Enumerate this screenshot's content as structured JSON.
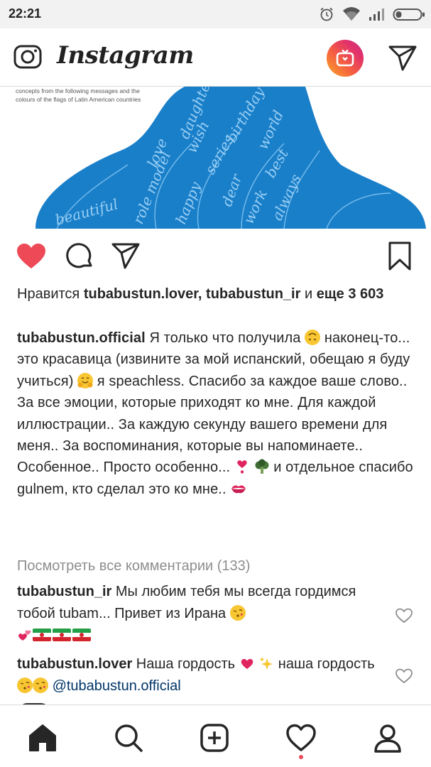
{
  "status_bar": {
    "time": "22:21",
    "icons": [
      "alarm-icon",
      "wifi-icon",
      "signal-icon",
      "battery-icon"
    ]
  },
  "header": {
    "logo_text": "Instagram",
    "icons": [
      "camera-icon",
      "igtv-icon",
      "direct-message-icon"
    ],
    "igtv_gradient": [
      "#f9a826",
      "#e1306c",
      "#c13584"
    ]
  },
  "post": {
    "image_caption_line1": "concepts from the following messages and the",
    "image_caption_line2": "colours of the flags of Latin American countries",
    "image_words": [
      "beautiful",
      "role model",
      "love",
      "daughter",
      "happy",
      "series",
      "wish",
      "birthday",
      "dear",
      "world",
      "work",
      "best",
      "always"
    ],
    "image_blue": "#1a7fc9",
    "liked": true,
    "like_color": "#ed4956"
  },
  "likes": {
    "prefix": "Нравится ",
    "users": "tubabustun.lover, tubabustun_ir",
    "and": " и ",
    "more": "еще 3 603"
  },
  "caption": {
    "username": "tubabustun.official",
    "part1": " Я только что получила ",
    "part2": " наконец-то... это красавица (извините за мой испанский, обещаю я буду учиться) ",
    "part3": " я speachless. Спасибо за каждое ваше слово.. За все эмоции, которые приходят ко мне. Для каждой иллюстрации.. За каждую секунду вашего времени для меня.. За воспоминания, которые вы напоминаете.. Особенное.. Просто особенно... ",
    "part4": " и отдельное спасибо gulnem, кто сделал это ко мне.. "
  },
  "view_all_comments": "Посмотреть все комментарии (133)",
  "comments": [
    {
      "username": "tubabustun_ir",
      "text": " Мы любим тебя мы всегда гордимся тобой tubam... Привет из Ирана "
    },
    {
      "username": "tubabustun.lover",
      "text": " Наша гордость ",
      "text2": " наша гордость ",
      "mention": "@tubabustun.official"
    }
  ],
  "bottom_nav": {
    "items": [
      "home-icon",
      "search-icon",
      "new-post-icon",
      "activity-icon",
      "profile-icon"
    ],
    "activity_dot_color": "#ed4956"
  }
}
